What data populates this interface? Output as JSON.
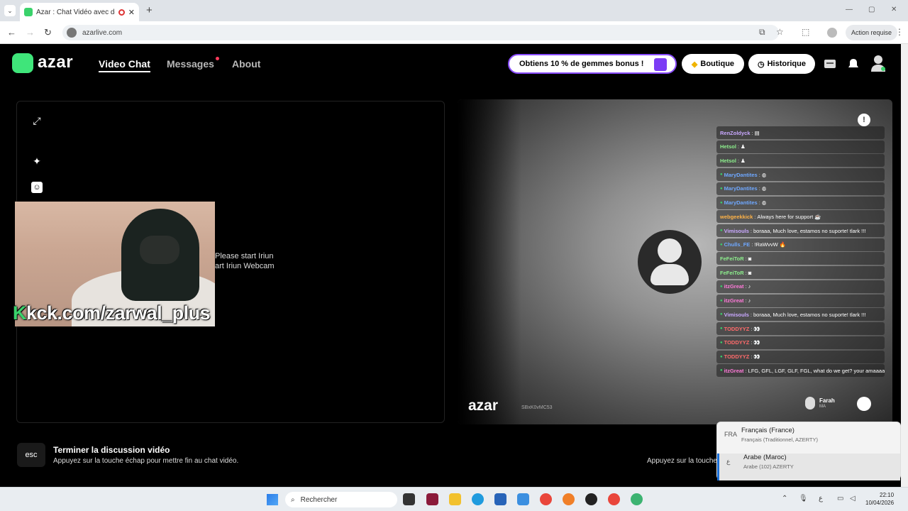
{
  "browser": {
    "tab_title": "Azar : Chat Vidéo avec de n",
    "url": "azarlive.com",
    "action_required": "Action requise"
  },
  "header": {
    "logo_text": "azar",
    "nav": [
      {
        "label": "Video Chat",
        "active": true
      },
      {
        "label": "Messages",
        "active": false
      },
      {
        "label": "About",
        "active": false
      }
    ],
    "promo": "Obtiens 10 % de gemmes bonus !",
    "shop": "Boutique",
    "history": "Historique"
  },
  "left_video": {
    "mirrored_prompt_1": "Please start Iriun",
    "mirrored_prompt_2": "art Iriun Webcam",
    "overlay_k": "K",
    "overlay_text": "kck.com/zarwal_plus"
  },
  "chat": [
    {
      "user": "RenZoldyck",
      "color": "#c9a8ff",
      "badge": false,
      "text": "▤"
    },
    {
      "user": "Hetsol",
      "color": "#8df08d",
      "badge": false,
      "text": "♟"
    },
    {
      "user": "Hetsol",
      "color": "#8df08d",
      "badge": false,
      "text": "♟"
    },
    {
      "user": "MaryDantites",
      "color": "#6fa8ff",
      "badge": true,
      "text": "◍"
    },
    {
      "user": "MaryDantites",
      "color": "#6fa8ff",
      "badge": true,
      "text": "◍"
    },
    {
      "user": "MaryDantites",
      "color": "#6fa8ff",
      "badge": true,
      "text": "◍"
    },
    {
      "user": "webgeekkick",
      "color": "#ffb347",
      "badge": false,
      "text": "Always here for support ☕"
    },
    {
      "user": "Vimisouls",
      "color": "#c9a8ff",
      "badge": true,
      "text": "boraaa, Much love, estamos no suporte! tlark !!!"
    },
    {
      "user": "Chulls_FE",
      "color": "#6fa8ff",
      "badge": true,
      "text": "!RaWvvW 🔥"
    },
    {
      "user": "FeFeiToR",
      "color": "#8df08d",
      "badge": false,
      "text": "◙"
    },
    {
      "user": "FeFeiToR",
      "color": "#8df08d",
      "badge": false,
      "text": "◙"
    },
    {
      "user": "itzGreat",
      "color": "#ff7ad9",
      "badge": true,
      "text": "♪"
    },
    {
      "user": "itzGreat",
      "color": "#ff7ad9",
      "badge": true,
      "text": "♪"
    },
    {
      "user": "Vimisouls",
      "color": "#c9a8ff",
      "badge": true,
      "text": "boraaa, Much love, estamos no suporte! tlark !!!"
    },
    {
      "user": "TODDYYZ",
      "color": "#ff6b6b",
      "badge": true,
      "text": "👀"
    },
    {
      "user": "TODDYYZ",
      "color": "#ff6b6b",
      "badge": true,
      "text": "👀"
    },
    {
      "user": "TODDYYZ",
      "color": "#ff6b6b",
      "badge": true,
      "text": "👀"
    },
    {
      "user": "itzGreat",
      "color": "#ff7ad9",
      "badge": true,
      "text": "LFG, GFL, LGF, GLF, FGL, what do we get? your amaaaaizing 💚"
    }
  ],
  "right_video": {
    "watermark": "azar",
    "code": "SBxK0vMC53",
    "partner_name": "Farah",
    "partner_country": "MA"
  },
  "footer": {
    "esc": "esc",
    "end_title": "Terminer la discussion vidéo",
    "end_sub": "Appuyez sur la touche échap pour mettre fin au chat vidéo.",
    "right_hint": "Appuyez sur la touche"
  },
  "language_popup": [
    {
      "code": "FRA",
      "name": "Français (France)",
      "sub": "Français (Traditionnel, AZERTY)",
      "selected": false
    },
    {
      "code": "ع",
      "name": "Arabe (Maroc)",
      "sub": "Arabe (102) AZERTY",
      "selected": true
    }
  ],
  "taskbar": {
    "search": "Rechercher",
    "time": "22:10",
    "date": "10/04/2026",
    "ime": "ع"
  }
}
